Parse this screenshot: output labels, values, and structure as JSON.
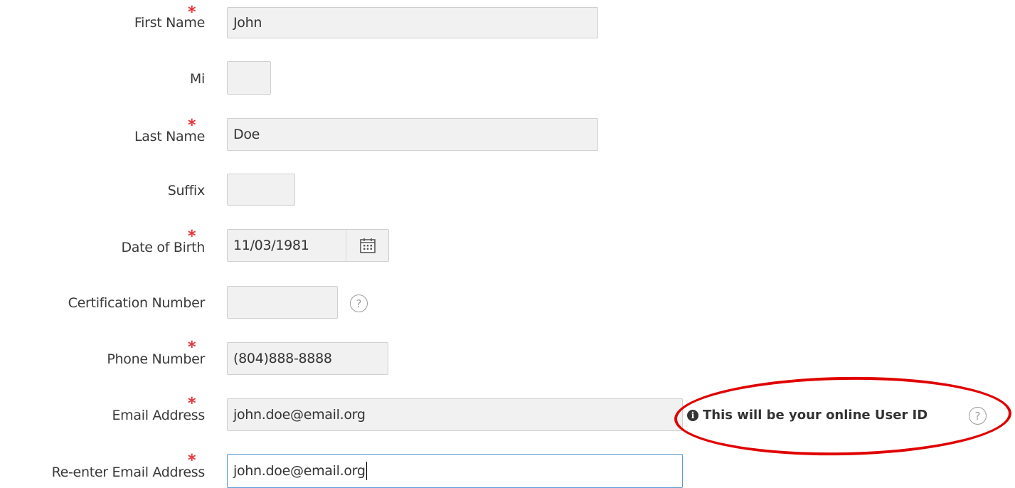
{
  "form": {
    "fields": [
      {
        "key": "first_name",
        "label": "First Name",
        "required": true,
        "value": ""
      },
      {
        "key": "mi",
        "label": "Mi",
        "required": false,
        "value": ""
      },
      {
        "key": "last_name",
        "label": "Last Name",
        "required": true,
        "value": ""
      },
      {
        "key": "suffix",
        "label": "Suffix",
        "required": false,
        "value": ""
      },
      {
        "key": "dob",
        "label": "Date of Birth",
        "required": true,
        "value": ""
      },
      {
        "key": "cert",
        "label": "Certification Number",
        "required": false,
        "value": ""
      },
      {
        "key": "phone",
        "label": "Phone Number",
        "required": true,
        "value": ""
      },
      {
        "key": "email",
        "label": "Email Address",
        "required": true,
        "value": ""
      },
      {
        "key": "email_confirm",
        "label": "Re-enter Email Address",
        "required": true,
        "value": ""
      }
    ],
    "first_name": {
      "label": "First Name",
      "value": "John"
    },
    "mi": {
      "label": "Mi",
      "value": ""
    },
    "last_name": {
      "label": "Last Name",
      "value": "Doe"
    },
    "suffix": {
      "label": "Suffix",
      "value": ""
    },
    "dob": {
      "label": "Date of Birth",
      "value": "11/03/1981"
    },
    "cert": {
      "label": "Certification Number",
      "value": ""
    },
    "phone": {
      "label": "Phone Number",
      "value": "(804)888-8888"
    },
    "email": {
      "label": "Email Address",
      "value": "john.doe@email.org"
    },
    "email_confirm": {
      "label": "Re-enter Email Address",
      "value": "john.doe@email.org"
    },
    "required_marker": "*",
    "email_hint": "This will be your online User ID",
    "help_glyph": "?",
    "info_glyph": "i"
  },
  "icons": {
    "calendar": "calendar-icon",
    "help": "question-circle-icon",
    "info": "info-circle-icon"
  },
  "colors": {
    "required": "#e8343c",
    "annotation": "#e00000",
    "focus_border": "#5b9bd5",
    "input_bg": "#f1f1f1"
  }
}
